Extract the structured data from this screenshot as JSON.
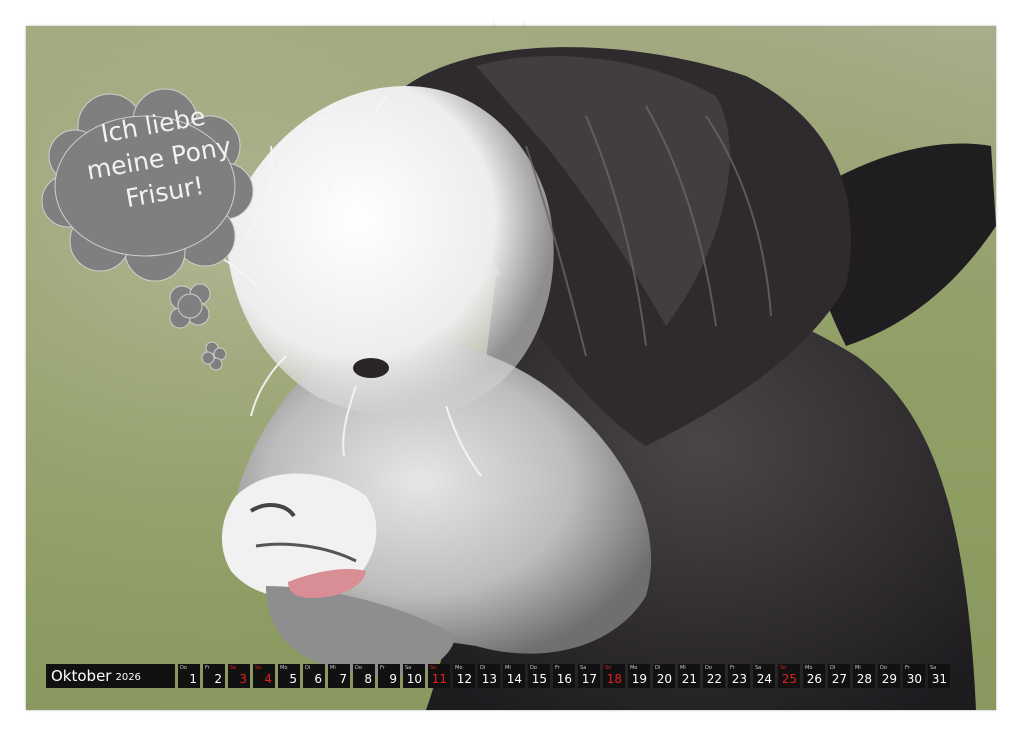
{
  "speech_bubble": {
    "lines": [
      "Ich liebe",
      "meine Pony",
      "Frisur!"
    ],
    "fill_color": "#7f7f7f",
    "text_color": "#f2f2f2"
  },
  "photo": {
    "subject": "alpaca-head-icon",
    "background_color": "#93a06a"
  },
  "calendar": {
    "month": "Oktober",
    "year": "2026",
    "highlight_color": "#e3201f",
    "days": [
      {
        "wd": "Do",
        "num": "1",
        "red": false
      },
      {
        "wd": "Fr",
        "num": "2",
        "red": false
      },
      {
        "wd": "Sa",
        "num": "3",
        "red": true
      },
      {
        "wd": "So",
        "num": "4",
        "red": true
      },
      {
        "wd": "Mo",
        "num": "5",
        "red": false
      },
      {
        "wd": "Di",
        "num": "6",
        "red": false
      },
      {
        "wd": "Mi",
        "num": "7",
        "red": false
      },
      {
        "wd": "Do",
        "num": "8",
        "red": false
      },
      {
        "wd": "Fr",
        "num": "9",
        "red": false
      },
      {
        "wd": "Sa",
        "num": "10",
        "red": false
      },
      {
        "wd": "So",
        "num": "11",
        "red": true
      },
      {
        "wd": "Mo",
        "num": "12",
        "red": false
      },
      {
        "wd": "Di",
        "num": "13",
        "red": false
      },
      {
        "wd": "Mi",
        "num": "14",
        "red": false
      },
      {
        "wd": "Do",
        "num": "15",
        "red": false
      },
      {
        "wd": "Fr",
        "num": "16",
        "red": false
      },
      {
        "wd": "Sa",
        "num": "17",
        "red": false
      },
      {
        "wd": "So",
        "num": "18",
        "red": true
      },
      {
        "wd": "Mo",
        "num": "19",
        "red": false
      },
      {
        "wd": "Di",
        "num": "20",
        "red": false
      },
      {
        "wd": "Mi",
        "num": "21",
        "red": false
      },
      {
        "wd": "Do",
        "num": "22",
        "red": false
      },
      {
        "wd": "Fr",
        "num": "23",
        "red": false
      },
      {
        "wd": "Sa",
        "num": "24",
        "red": false
      },
      {
        "wd": "So",
        "num": "25",
        "red": true
      },
      {
        "wd": "Mo",
        "num": "26",
        "red": false
      },
      {
        "wd": "Di",
        "num": "27",
        "red": false
      },
      {
        "wd": "Mi",
        "num": "28",
        "red": false
      },
      {
        "wd": "Do",
        "num": "29",
        "red": false
      },
      {
        "wd": "Fr",
        "num": "30",
        "red": false
      },
      {
        "wd": "Sa",
        "num": "31",
        "red": false
      }
    ]
  }
}
